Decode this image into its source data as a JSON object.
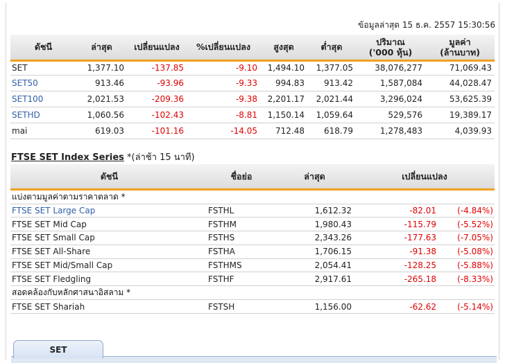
{
  "update_text": "ข้อมูลล่าสุด 15 ธ.ค. 2557 15:30:56",
  "index_table": {
    "headers": {
      "index": "ดัชนี",
      "last": "ล่าสุด",
      "change": "เปลี่ยนแปลง",
      "pct_change": "%เปลี่ยนแปลง",
      "high": "สูงสุด",
      "low": "ต่ำสุด",
      "volume_line1": "ปริมาณ",
      "volume_line2": "('000 หุ้น)",
      "value_line1": "มูลค่า",
      "value_line2": "(ล้านบาท)"
    },
    "rows": [
      {
        "name": "SET",
        "last": "1,377.10",
        "change": "-137.85",
        "pct": "-9.10",
        "high": "1,494.10",
        "low": "1,377.05",
        "volume": "38,076,277",
        "value": "71,069.43"
      },
      {
        "name": "SET50",
        "last": "913.46",
        "change": "-93.96",
        "pct": "-9.33",
        "high": "994.83",
        "low": "913.42",
        "volume": "1,587,084",
        "value": "44,028.47"
      },
      {
        "name": "SET100",
        "last": "2,021.53",
        "change": "-209.36",
        "pct": "-9.38",
        "high": "2,201.17",
        "low": "2,021.44",
        "volume": "3,296,024",
        "value": "53,625.39"
      },
      {
        "name": "SETHD",
        "last": "1,060.56",
        "change": "-102.43",
        "pct": "-8.81",
        "high": "1,150.14",
        "low": "1,059.64",
        "volume": "529,576",
        "value": "19,389.17"
      },
      {
        "name": "mai",
        "last": "619.03",
        "change": "-101.16",
        "pct": "-14.05",
        "high": "712.48",
        "low": "618.79",
        "volume": "1,278,483",
        "value": "4,039.93"
      }
    ]
  },
  "ftse": {
    "title": "FTSE SET Index Series",
    "note": "*(ล่าช้า 15 นาที)",
    "headers": {
      "index": "ดัชนี",
      "symbol": "ชื่อย่อ",
      "last": "ล่าสุด",
      "change": "เปลี่ยนแปลง"
    },
    "section1": "แบ่งตามมูลค่าตามราคาตลาด *",
    "rows1": [
      {
        "name": "FTSE SET Large Cap",
        "symbol": "FSTHL",
        "last": "1,612.32",
        "change": "-82.01",
        "pct": "(-4.84%)"
      },
      {
        "name": "FTSE SET Mid Cap",
        "symbol": "FSTHM",
        "last": "1,980.43",
        "change": "-115.79",
        "pct": "(-5.52%)"
      },
      {
        "name": "FTSE SET Small Cap",
        "symbol": "FSTHS",
        "last": "2,343.26",
        "change": "-177.63",
        "pct": "(-7.05%)"
      },
      {
        "name": "FTSE SET All-Share",
        "symbol": "FSTHA",
        "last": "1,706.15",
        "change": "-91.38",
        "pct": "(-5.08%)"
      },
      {
        "name": "FTSE SET Mid/Small Cap",
        "symbol": "FSTHMS",
        "last": "2,054.41",
        "change": "-128.25",
        "pct": "(-5.88%)"
      },
      {
        "name": "FTSE SET Fledgling",
        "symbol": "FSTHF",
        "last": "2,917.61",
        "change": "-265.18",
        "pct": "(-8.33%)"
      }
    ],
    "section2": "สอดคล้องกับหลักศาสนาอิสลาม *",
    "rows2": [
      {
        "name": "FTSE SET Shariah",
        "symbol": "FSTSH",
        "last": "1,156.00",
        "change": "-62.62",
        "pct": "(-5.14%)"
      }
    ]
  },
  "tabs": [
    {
      "label": "SET"
    }
  ],
  "colors": {
    "accent": "#f0a020",
    "negative": "#e00000",
    "link": "#2f5fa7"
  }
}
